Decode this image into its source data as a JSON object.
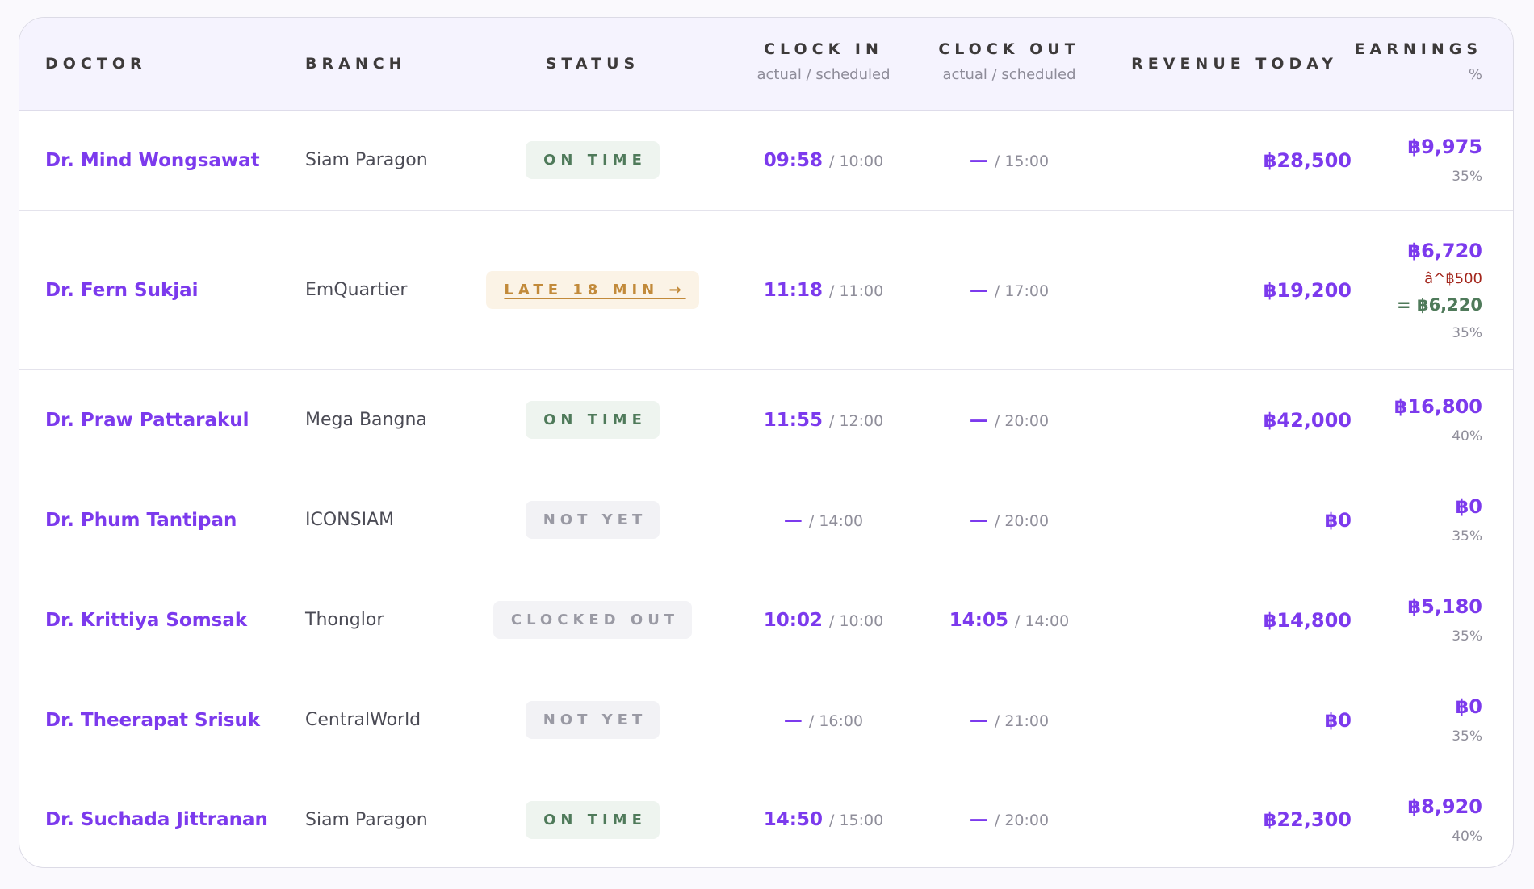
{
  "header": {
    "doctor": "DOCTOR",
    "branch": "BRANCH",
    "status": "STATUS",
    "clock_in": "CLOCK IN",
    "clock_in_sub": "actual / scheduled",
    "clock_out": "CLOCK OUT",
    "clock_out_sub": "actual / scheduled",
    "revenue": "REVENUE TODAY",
    "earnings": "EARNINGS",
    "earnings_sub": "%"
  },
  "rows": [
    {
      "doctor": "Dr. Mind Wongsawat",
      "branch": "Siam Paragon",
      "status": "ON TIME",
      "in_actual": "09:58",
      "in_sched": "/ 10:00",
      "out_actual": "—",
      "out_sched": "/ 15:00",
      "revenue": "฿28,500",
      "earnings": "฿9,975",
      "pct": "35%"
    },
    {
      "doctor": "Dr. Fern Sukjai",
      "branch": "EmQuartier",
      "status": "LATE 18 MIN →",
      "in_actual": "11:18",
      "in_sched": "/ 11:00",
      "out_actual": "—",
      "out_sched": "/ 17:00",
      "revenue": "฿19,200",
      "earnings": "฿6,720",
      "deduction": "â^฿500",
      "net": "= ฿6,220",
      "pct": "35%"
    },
    {
      "doctor": "Dr. Praw Pattarakul",
      "branch": "Mega Bangna",
      "status": "ON TIME",
      "in_actual": "11:55",
      "in_sched": "/ 12:00",
      "out_actual": "—",
      "out_sched": "/ 20:00",
      "revenue": "฿42,000",
      "earnings": "฿16,800",
      "pct": "40%"
    },
    {
      "doctor": "Dr. Phum Tantipan",
      "branch": "ICONSIAM",
      "status": "NOT YET",
      "in_actual": "—",
      "in_sched": "/ 14:00",
      "out_actual": "—",
      "out_sched": "/ 20:00",
      "revenue": "฿0",
      "earnings": "฿0",
      "pct": "35%"
    },
    {
      "doctor": "Dr. Krittiya Somsak",
      "branch": "Thonglor",
      "status": "CLOCKED OUT",
      "in_actual": "10:02",
      "in_sched": "/ 10:00",
      "out_actual": "14:05",
      "out_sched": "/ 14:00",
      "revenue": "฿14,800",
      "earnings": "฿5,180",
      "pct": "35%"
    },
    {
      "doctor": "Dr. Theerapat Srisuk",
      "branch": "CentralWorld",
      "status": "NOT YET",
      "in_actual": "—",
      "in_sched": "/ 16:00",
      "out_actual": "—",
      "out_sched": "/ 21:00",
      "revenue": "฿0",
      "earnings": "฿0",
      "pct": "35%"
    },
    {
      "doctor": "Dr. Suchada Jittranan",
      "branch": "Siam Paragon",
      "status": "ON TIME",
      "in_actual": "14:50",
      "in_sched": "/ 15:00",
      "out_actual": "—",
      "out_sched": "/ 20:00",
      "revenue": "฿22,300",
      "earnings": "฿8,920",
      "pct": "40%"
    }
  ]
}
